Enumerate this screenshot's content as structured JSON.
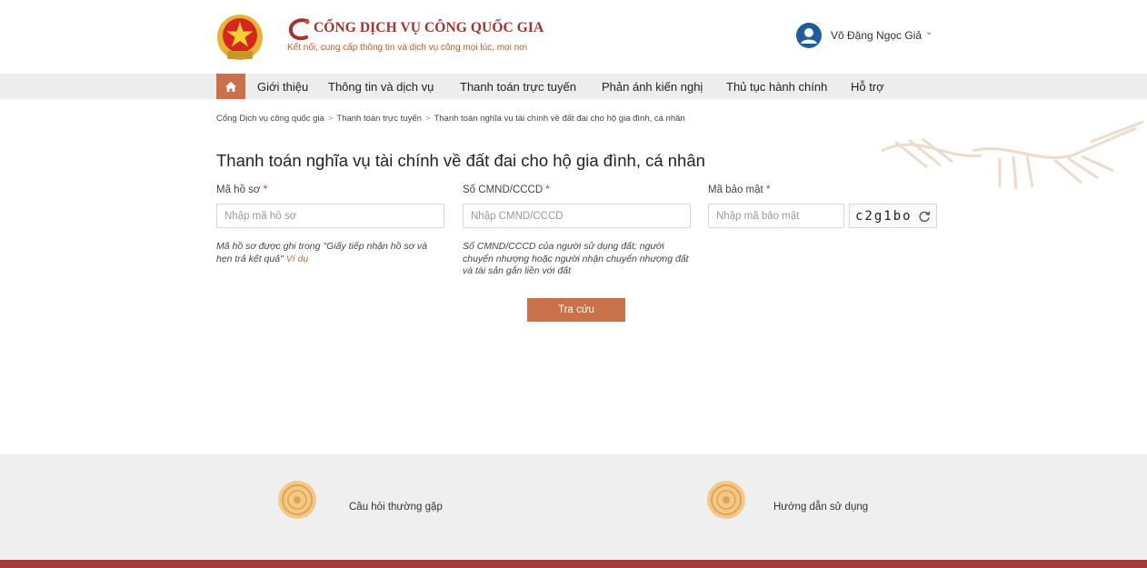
{
  "header": {
    "title": "CỔNG DỊCH VỤ CÔNG QUỐC GIA",
    "subtitle": "Kết nối, cung cấp thông tin và dịch vụ công mọi lúc, mọi nơi",
    "user_name": "Võ Đặng Ngọc Giả"
  },
  "nav": {
    "items": [
      {
        "label": "Giới thiệu"
      },
      {
        "label": "Thông tin và dịch vụ"
      },
      {
        "label": "Thanh toán trực tuyến"
      },
      {
        "label": "Phản ánh kiến nghị"
      },
      {
        "label": "Thủ tục hành chính"
      },
      {
        "label": "Hỗ trợ"
      }
    ]
  },
  "breadcrumb": [
    "Cổng Dịch vụ công quốc gia",
    "Thanh toán trực tuyến",
    "Thanh toán nghĩa vụ tài chính về đất đai cho hộ gia đình, cá nhân"
  ],
  "form": {
    "title": "Thanh toán nghĩa vụ tài chính về đất đai cho hộ gia đình, cá nhân",
    "fields": {
      "ma_ho_so": {
        "label": "Mã hồ sơ",
        "placeholder": "Nhập mã hồ sơ",
        "value": ""
      },
      "cmnd": {
        "label": "Số CMND/CCCD",
        "placeholder": "Nhập CMND/CCCD",
        "value": ""
      },
      "captcha": {
        "label": "Mã bảo mật",
        "placeholder": "Nhập mã bảo mật",
        "value": ""
      }
    },
    "required_mark": "*",
    "captcha_code": "c2g1bo",
    "hint_ho_so": "Mã hồ sơ được ghi trong \"Giấy tiếp nhận hồ sơ và hẹn trả kết quả\"",
    "hint_ho_so_link": "Ví dụ",
    "hint_cmnd": "Số CMND/CCCD của người sử dụng đất; người chuyển nhượng hoặc người nhận chuyển nhượng đất và tài sản gắn liền với đất",
    "submit_label": "Tra cứu"
  },
  "footer": {
    "faq": "Câu hỏi thường gặp",
    "guide": "Hướng dẫn sử dụng"
  },
  "colors": {
    "brand_red": "#a4342b",
    "accent": "#c8714a",
    "bottom_bar": "#a33b36"
  }
}
